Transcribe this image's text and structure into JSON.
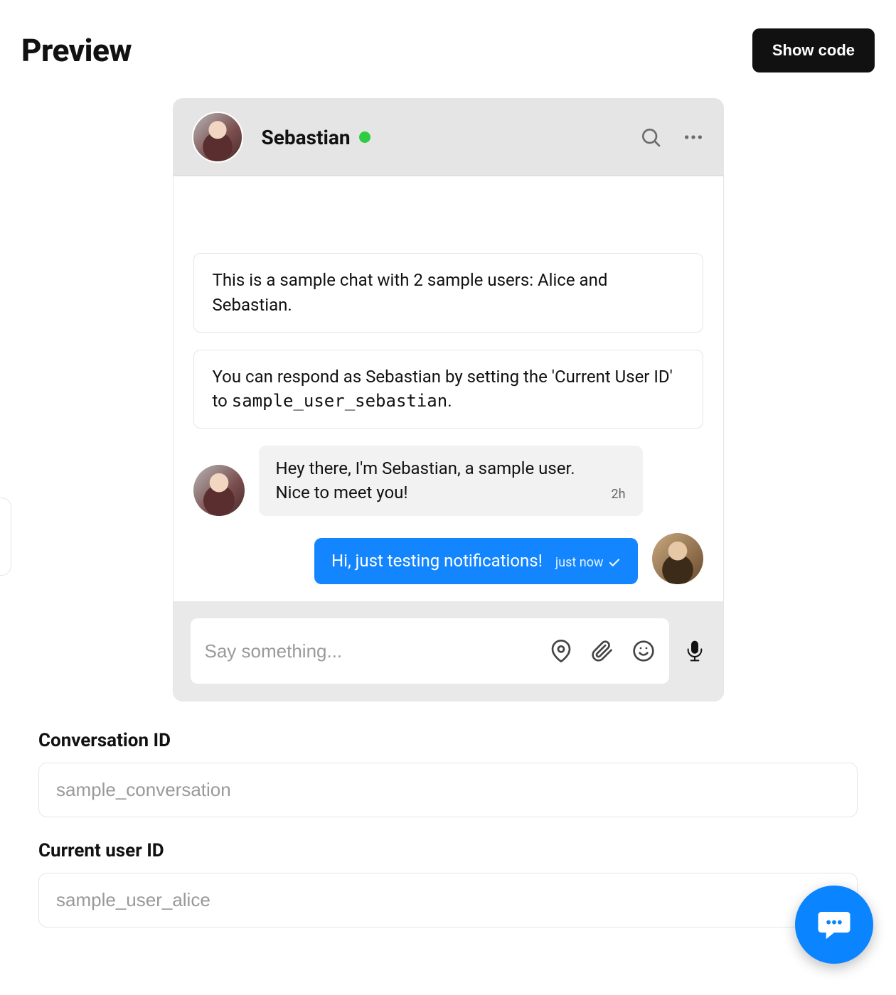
{
  "header": {
    "title": "Preview",
    "show_code_label": "Show code"
  },
  "chat": {
    "participant_name": "Sebastian",
    "status": "online",
    "system_messages": [
      {
        "text": "This is a sample chat with 2 sample users: Alice and Sebastian."
      },
      {
        "text_prefix": "You can respond as Sebastian by setting the 'Current User ID' to ",
        "code": "sample_user_sebastian",
        "text_suffix": "."
      }
    ],
    "messages": [
      {
        "direction": "incoming",
        "sender": "Sebastian",
        "text": "Hey there, I'm Sebastian, a sample user. Nice to meet you!",
        "time": "2h"
      },
      {
        "direction": "outgoing",
        "sender": "Alice",
        "text": "Hi, just testing notifications!",
        "time": "just now",
        "status": "sent"
      }
    ],
    "composer_placeholder": "Say something..."
  },
  "fields": {
    "conversation_id_label": "Conversation ID",
    "conversation_id_value": "sample_conversation",
    "current_user_id_label": "Current user ID",
    "current_user_id_value": "sample_user_alice"
  },
  "icons": {
    "search": "search-icon",
    "more": "more-icon",
    "location": "location-pin-icon",
    "attachment": "paperclip-icon",
    "emoji": "smiley-icon",
    "mic": "microphone-icon",
    "check": "check-icon",
    "chat_fab": "chat-bubble-icon"
  },
  "colors": {
    "accent": "#1386ff",
    "status_online": "#2ecc40",
    "button_dark": "#111111"
  }
}
